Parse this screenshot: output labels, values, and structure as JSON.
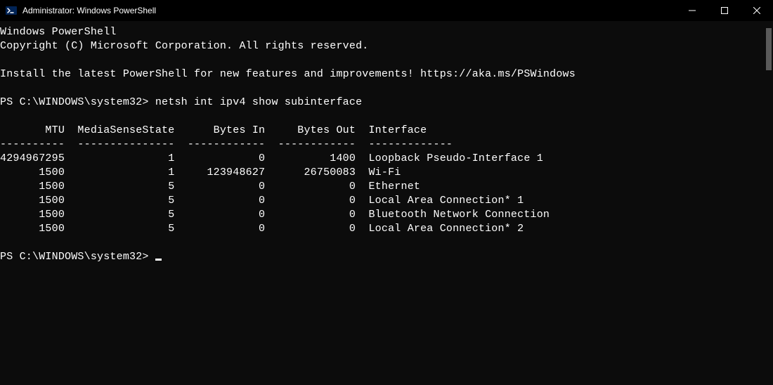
{
  "window": {
    "title": "Administrator: Windows PowerShell"
  },
  "terminal": {
    "banner_line1": "Windows PowerShell",
    "banner_line2": "Copyright (C) Microsoft Corporation. All rights reserved.",
    "install_line": "Install the latest PowerShell for new features and improvements! https://aka.ms/PSWindows",
    "prompt1": "PS C:\\WINDOWS\\system32> ",
    "command1": "netsh int ipv4 show subinterface",
    "table": {
      "header": "       MTU  MediaSenseState      Bytes In     Bytes Out  Interface",
      "divider": "----------  ---------------  ------------  ------------  -------------",
      "rows": [
        "4294967295                1             0          1400  Loopback Pseudo-Interface 1",
        "      1500                1     123948627      26750083  Wi-Fi",
        "      1500                5             0             0  Ethernet",
        "      1500                5             0             0  Local Area Connection* 1",
        "      1500                5             0             0  Bluetooth Network Connection",
        "      1500                5             0             0  Local Area Connection* 2"
      ]
    },
    "prompt2": "PS C:\\WINDOWS\\system32> "
  }
}
